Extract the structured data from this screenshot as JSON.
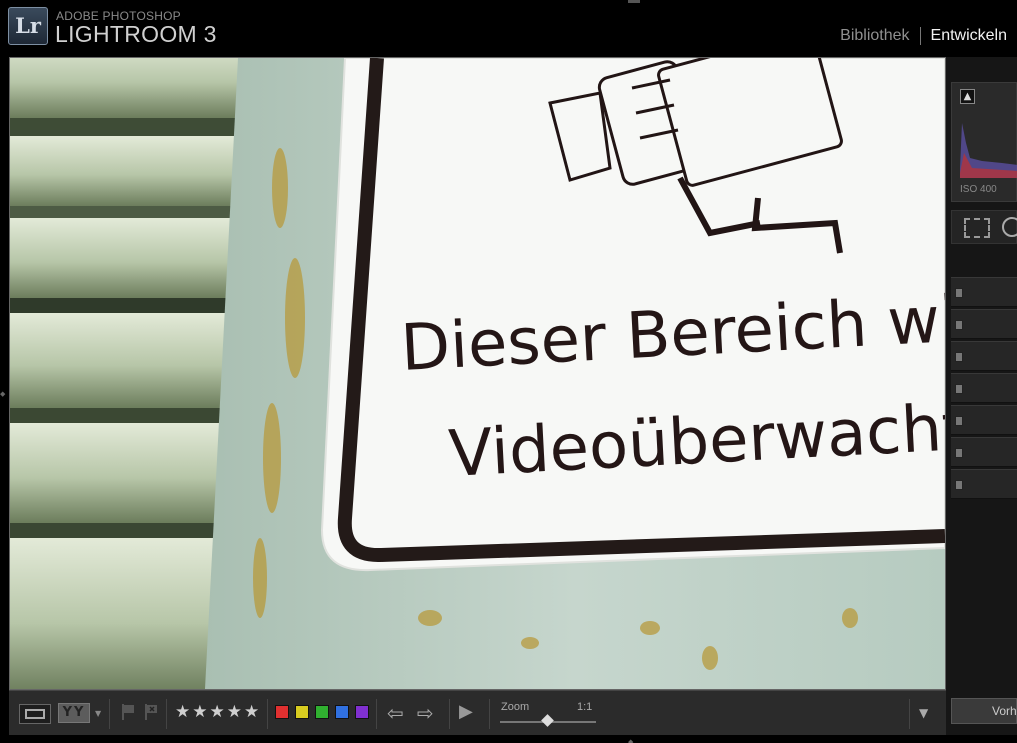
{
  "app": {
    "logo_text": "Lr",
    "brand_line1": "ADOBE PHOTOSHOP",
    "brand_line2": "LIGHTROOM 3"
  },
  "modules": [
    {
      "label": "Bibliothek",
      "active": false
    },
    {
      "label": "Entwickeln",
      "active": true
    }
  ],
  "photo": {
    "sign_line1": "Dieser Bereich wir",
    "sign_line2": "Videoüberwacht"
  },
  "right_panel": {
    "histogram_iso": "ISO 400",
    "clip_indicator": "▲",
    "presets_button": "Vorher"
  },
  "toolbar": {
    "yy_label": "YY",
    "stars": "★★★★★",
    "color_labels": [
      "#e03030",
      "#d8cc20",
      "#30b030",
      "#3070e0",
      "#8030d0"
    ],
    "zoom_label": "Zoom",
    "zoom_value": "1:1"
  }
}
